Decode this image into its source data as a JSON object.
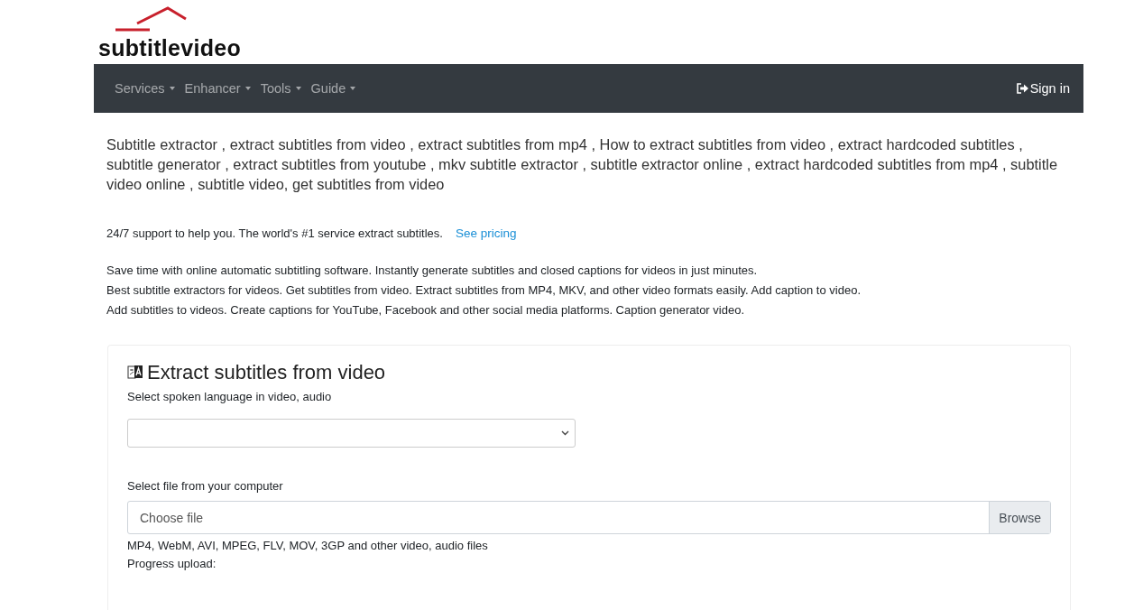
{
  "logo": {
    "text": "subtitlevideo"
  },
  "navbar": {
    "items": [
      {
        "label": "Services"
      },
      {
        "label": "Enhancer"
      },
      {
        "label": "Tools"
      },
      {
        "label": "Guide"
      }
    ],
    "sign_in": "Sign in"
  },
  "keywords": "Subtitle extractor , extract subtitles from video , extract subtitles from mp4 , How to extract subtitles from video , extract hardcoded subtitles , subtitle generator , extract subtitles from youtube , mkv subtitle extractor , subtitle extractor online , extract hardcoded subtitles from mp4 , subtitle video online , subtitle video, get subtitles from video",
  "support": {
    "text": "24/7 support to help you. The world's #1 service extract subtitles.",
    "link": "See pricing"
  },
  "description": [
    "Save time with online automatic subtitling software. Instantly generate subtitles and closed captions for videos in just minutes.",
    "Best subtitle extractors for videos. Get subtitles from video. Extract subtitles from MP4, MKV, and other video formats easily. Add caption to video.",
    "Add subtitles to videos. Create captions for YouTube, Facebook and other social media platforms. Caption generator video."
  ],
  "card": {
    "title": "Extract subtitles from video",
    "language_label": "Select spoken language in video, audio",
    "file_label": "Select file from your computer",
    "file_placeholder": "Choose file",
    "browse": "Browse",
    "formats": "MP4, WebM, AVI, MPEG, FLV, MOV, 3GP and other video, audio files",
    "progress_label": "Progress upload:"
  }
}
